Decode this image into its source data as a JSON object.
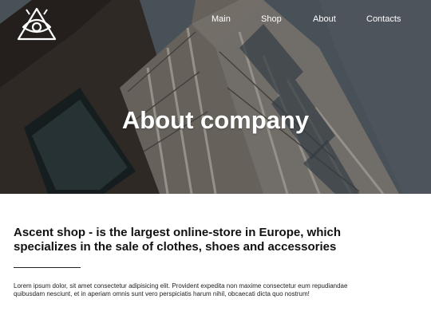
{
  "header": {
    "logo_icon": "triangle-eye-logo",
    "nav": [
      {
        "label": "Main"
      },
      {
        "label": "Shop"
      },
      {
        "label": "About"
      },
      {
        "label": "Contacts"
      }
    ]
  },
  "hero": {
    "title": "About company",
    "background": "building-photo"
  },
  "content": {
    "headline": "Ascent shop - is the largest online-store in Europe, which specializes in the sale of clothes, shoes and accessories",
    "paragraph": "Lorem ipsum dolor, sit amet consectetur adipisicing elit. Provident expedita non maxime consectetur eum repudiandae quibusdam nesciunt, et in aperiam omnis sunt vero perspiciatis harum nihil, obcaecati dicta quo nostrum!"
  },
  "colors": {
    "text_dark": "#111111",
    "hero_text": "#ffffff"
  }
}
